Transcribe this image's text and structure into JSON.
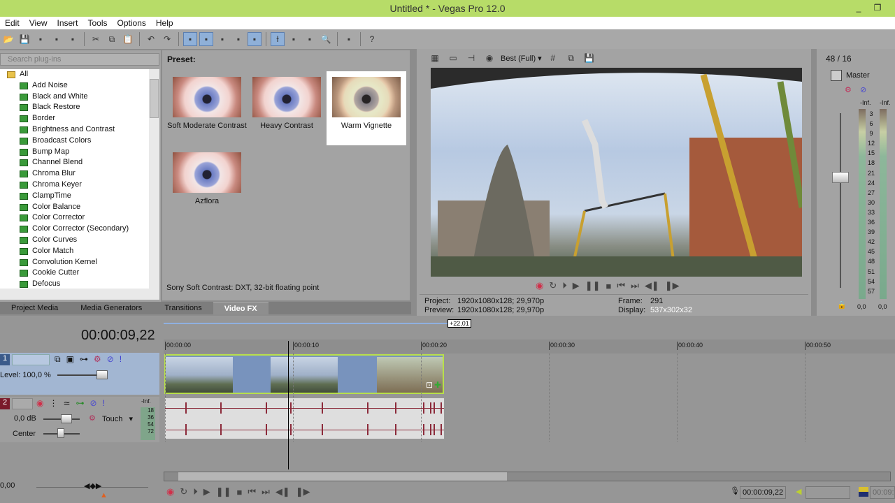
{
  "window": {
    "title": "Untitled * - Vegas Pro 12.0",
    "minimize": "_",
    "restore": "❐"
  },
  "menu": [
    "Edit",
    "View",
    "Insert",
    "Tools",
    "Options",
    "Help"
  ],
  "toolbar_icons": [
    "open-icon",
    "save-icon",
    "save-as-icon",
    "render-icon",
    "properties-icon",
    "|",
    "cut-icon",
    "copy-icon",
    "paste-icon",
    "|",
    "undo-icon",
    "redo-icon",
    "|",
    "auto-ripple-icon",
    "lock-envelopes-icon",
    "ignore-grouping-icon",
    "auto-crossfade-icon",
    "snapping-icon",
    "|",
    "normal-edit-tool-icon",
    "envelope-tool-icon",
    "selection-tool-icon",
    "zoom-tool-icon",
    "|",
    "enable-snapping-icon",
    "|",
    "whats-this-icon"
  ],
  "plugins": {
    "search_placeholder": "Search plug-ins",
    "root": "All",
    "items": [
      "Add Noise",
      "Black and White",
      "Black Restore",
      "Border",
      "Brightness and Contrast",
      "Broadcast Colors",
      "Bump Map",
      "Channel Blend",
      "Chroma Blur",
      "Chroma Keyer",
      "ClampTime",
      "Color Balance",
      "Color Corrector",
      "Color Corrector (Secondary)",
      "Color Curves",
      "Color Match",
      "Convolution Kernel",
      "Cookie Cutter",
      "Defocus"
    ]
  },
  "presets": {
    "label": "Preset:",
    "items": [
      {
        "name": "Soft Moderate Contrast",
        "selected": false
      },
      {
        "name": "Heavy Contrast",
        "selected": false
      },
      {
        "name": "Warm Vignette",
        "selected": true
      },
      {
        "name": "Azflora",
        "selected": false
      }
    ],
    "status": "Sony Soft Contrast: DXT, 32-bit floating point"
  },
  "tabs": [
    {
      "label": "Project Media",
      "active": false
    },
    {
      "label": "Media Generators",
      "active": false
    },
    {
      "label": "Transitions",
      "active": false
    },
    {
      "label": "Video FX",
      "active": true
    }
  ],
  "preview": {
    "quality": "Best (Full)",
    "project_label": "Project:",
    "project": "1920x1080x128; 29,970p",
    "preview_label": "Preview:",
    "preview": "1920x1080x128; 29,970p",
    "frame_label": "Frame:",
    "frame": "291",
    "display_label": "Display:",
    "display": "537x302x32"
  },
  "master": {
    "channels": "48 / 16",
    "title": "Master",
    "peak_left": "-Inf.",
    "peak_right": "-Inf.",
    "scale": [
      "3",
      "6",
      "9",
      "12",
      "15",
      "18",
      "21",
      "24",
      "27",
      "30",
      "33",
      "36",
      "39",
      "42",
      "45",
      "48",
      "51",
      "54",
      "57"
    ],
    "level_left": "0,0",
    "level_right": "0,0"
  },
  "timeline": {
    "timecode": "00:00:09,22",
    "loop_length": "+22,01",
    "ruler": [
      "00:00:00",
      "00:00:10",
      "00:00:20",
      "00:00:30",
      "00:00:40",
      "00:00:50"
    ],
    "track1": {
      "number": "1",
      "level": "Level: 100,0 %"
    },
    "track2": {
      "number": "2",
      "volume": "0,0 dB",
      "automation": "Touch",
      "pan": "Center",
      "peak": "-Inf.",
      "meter": [
        "18",
        "36",
        "54",
        "72"
      ]
    },
    "rate": "0,00",
    "cursor_time": "00:00:09,22",
    "end_time": "00:09:"
  },
  "colors": {
    "titlebar": "#b7dc68",
    "video_clip_border": "#b8e04a",
    "record": "#d0304a"
  }
}
